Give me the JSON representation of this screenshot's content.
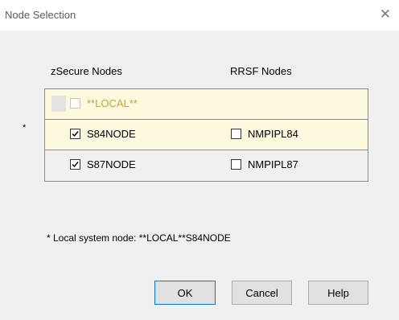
{
  "dialog": {
    "title": "Node Selection",
    "close_glyph": "✕"
  },
  "columns": {
    "zsecure_header": "zSecure Nodes",
    "rrsf_header": "RRSF Nodes"
  },
  "rows": [
    {
      "marker": "",
      "zsecure": {
        "label": "**LOCAL**",
        "checked": false,
        "enabled": false
      },
      "rrsf": null
    },
    {
      "marker": "*",
      "zsecure": {
        "label": "S84NODE",
        "checked": true,
        "enabled": true
      },
      "rrsf": {
        "label": "NMPIPL84",
        "checked": false
      }
    },
    {
      "marker": "",
      "zsecure": {
        "label": "S87NODE",
        "checked": true,
        "enabled": true
      },
      "rrsf": {
        "label": "NMPIPL87",
        "checked": false
      }
    }
  ],
  "footnote": "* Local system node: **LOCAL**S84NODE",
  "buttons": {
    "ok": "OK",
    "cancel": "Cancel",
    "help": "Help"
  },
  "colors": {
    "row_highlight": "#fcf9df",
    "disabled_text": "#c0a63a",
    "focus_border": "#0078d7"
  }
}
